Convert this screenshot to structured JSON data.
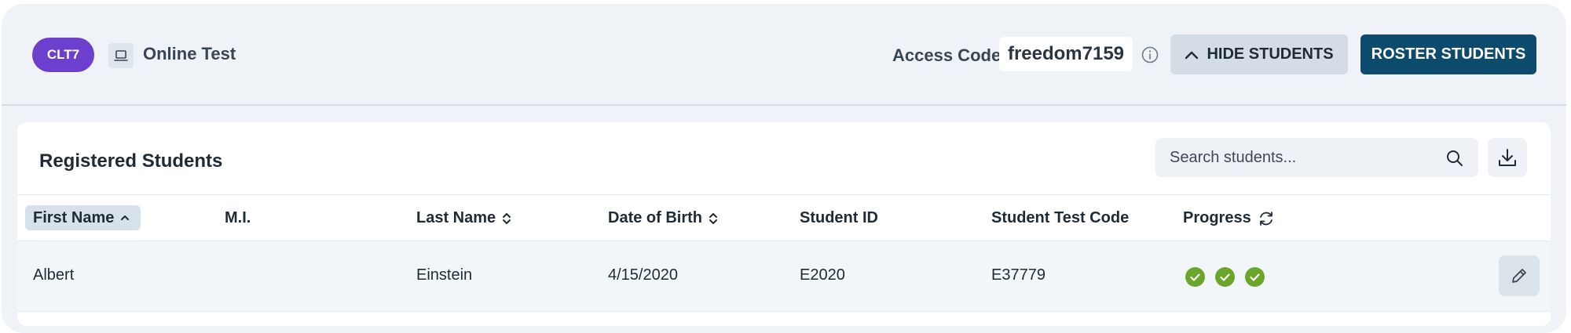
{
  "header": {
    "badge": "CLT7",
    "test_type_icon": "laptop-icon",
    "test_type": "Online Test",
    "access_label": "Access Code:",
    "access_code": "freedom7159",
    "hide_students_label": "HIDE STUDENTS",
    "roster_students_label": "ROSTER STUDENTS",
    "badge_color": "#6d3fce",
    "primary_color": "#0c4a6e"
  },
  "panel": {
    "title": "Registered Students",
    "search_placeholder": "Search students...",
    "columns": [
      {
        "label": "First Name",
        "sort": "ascending"
      },
      {
        "label": "M.I."
      },
      {
        "label": "Last Name",
        "sort": "sortable"
      },
      {
        "label": "Date of Birth",
        "sort": "sortable"
      },
      {
        "label": "Student ID"
      },
      {
        "label": "Student Test Code"
      },
      {
        "label": "Progress",
        "icon": "refresh-icon"
      }
    ],
    "rows": [
      {
        "first_name": "Albert",
        "mi": "",
        "last_name": "Einstein",
        "dob": "4/15/2020",
        "student_id": "E2020",
        "test_code": "E37779",
        "progress_completed": 3,
        "progress_color": "#6aa62a"
      }
    ]
  }
}
